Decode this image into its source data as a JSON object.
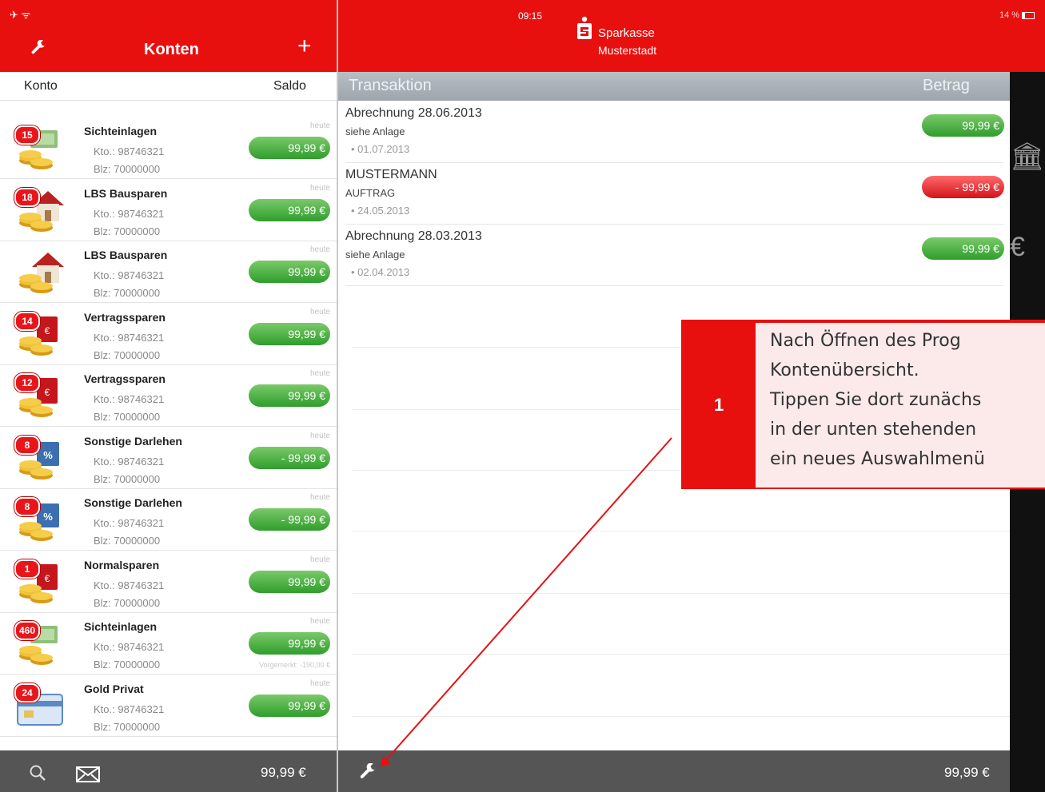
{
  "status_bar": {
    "time": "09:15",
    "battery": "14 %"
  },
  "left_nav": {
    "title": "Konten",
    "add_label": "+"
  },
  "brand": {
    "line1": "Sparkasse",
    "line2": "Musterstadt"
  },
  "accounts_header": {
    "konto": "Konto",
    "saldo": "Saldo"
  },
  "accounts": [
    {
      "name": "Sichteinlagen",
      "kto": "Kto.: 98746321",
      "blz": "Blz: 70000000",
      "heute": "heute",
      "amount": "99,99 €",
      "badge": "15",
      "icon": "cash-coins-icon",
      "note": ""
    },
    {
      "name": "LBS Bausparen",
      "kto": "Kto.: 98746321",
      "blz": "Blz: 70000000",
      "heute": "heute",
      "amount": "99,99 €",
      "badge": "18",
      "icon": "house-coins-icon",
      "note": ""
    },
    {
      "name": "LBS Bausparen",
      "kto": "Kto.: 98746321",
      "blz": "Blz: 70000000",
      "heute": "heute",
      "amount": "99,99 €",
      "badge": "",
      "icon": "house-coins-icon",
      "note": ""
    },
    {
      "name": "Vertragssparen",
      "kto": "Kto.: 98746321",
      "blz": "Blz: 70000000",
      "heute": "heute",
      "amount": "99,99 €",
      "badge": "14",
      "icon": "savings-book-icon",
      "note": ""
    },
    {
      "name": "Vertragssparen",
      "kto": "Kto.: 98746321",
      "blz": "Blz: 70000000",
      "heute": "heute",
      "amount": "99,99 €",
      "badge": "12",
      "icon": "savings-book-icon",
      "note": ""
    },
    {
      "name": "Sonstige Darlehen",
      "kto": "Kto.: 98746321",
      "blz": "Blz: 70000000",
      "heute": "heute",
      "amount": "- 99,99 €",
      "badge": "8",
      "icon": "loan-percent-icon",
      "note": ""
    },
    {
      "name": "Sonstige Darlehen",
      "kto": "Kto.: 98746321",
      "blz": "Blz: 70000000",
      "heute": "heute",
      "amount": "- 99,99 €",
      "badge": "8",
      "icon": "loan-percent-icon",
      "note": ""
    },
    {
      "name": "Normalsparen",
      "kto": "Kto.: 98746321",
      "blz": "Blz: 70000000",
      "heute": "heute",
      "amount": "99,99 €",
      "badge": "1",
      "icon": "savings-book-icon",
      "note": ""
    },
    {
      "name": "Sichteinlagen",
      "kto": "Kto.: 98746321",
      "blz": "Blz: 70000000",
      "heute": "heute",
      "amount": "99,99 €",
      "badge": "460",
      "icon": "cash-coins-icon",
      "note": "Vorgemerkt: -190,00 €"
    },
    {
      "name": "Gold Privat",
      "kto": "Kto.: 98746321",
      "blz": "Blz: 70000000",
      "heute": "heute",
      "amount": "99,99 €",
      "badge": "24",
      "icon": "credit-card-icon",
      "note": ""
    }
  ],
  "transactions_header": {
    "transaktion": "Transaktion",
    "betrag": "Betrag"
  },
  "transactions": [
    {
      "title": "Abrechnung 28.06.2013",
      "subtitle": "siehe Anlage",
      "date": "01.07.2013",
      "amount": "99,99 €",
      "kind": "credit"
    },
    {
      "title": "MUSTERMANN",
      "subtitle": "AUFTRAG",
      "date": "24.05.2013",
      "amount": "- 99,99 €",
      "kind": "debit"
    },
    {
      "title": "Abrechnung 28.03.2013",
      "subtitle": "siehe Anlage",
      "date": "02.04.2013",
      "amount": "99,99 €",
      "kind": "credit"
    }
  ],
  "callout": {
    "number": "1",
    "lines": [
      "Nach Öffnen des Prog",
      "Kontenübersicht.",
      "Tippen Sie dort zunächs",
      "in der unten stehenden",
      "ein neues Auswahlmenü"
    ]
  },
  "footer": {
    "left_total": "99,99 €",
    "right_total": "99,99 €"
  },
  "colors": {
    "brand_red": "#e8100f",
    "positive_green": "#2f9e2c",
    "negative_red": "#d4121a",
    "footer_gray": "#555555"
  }
}
